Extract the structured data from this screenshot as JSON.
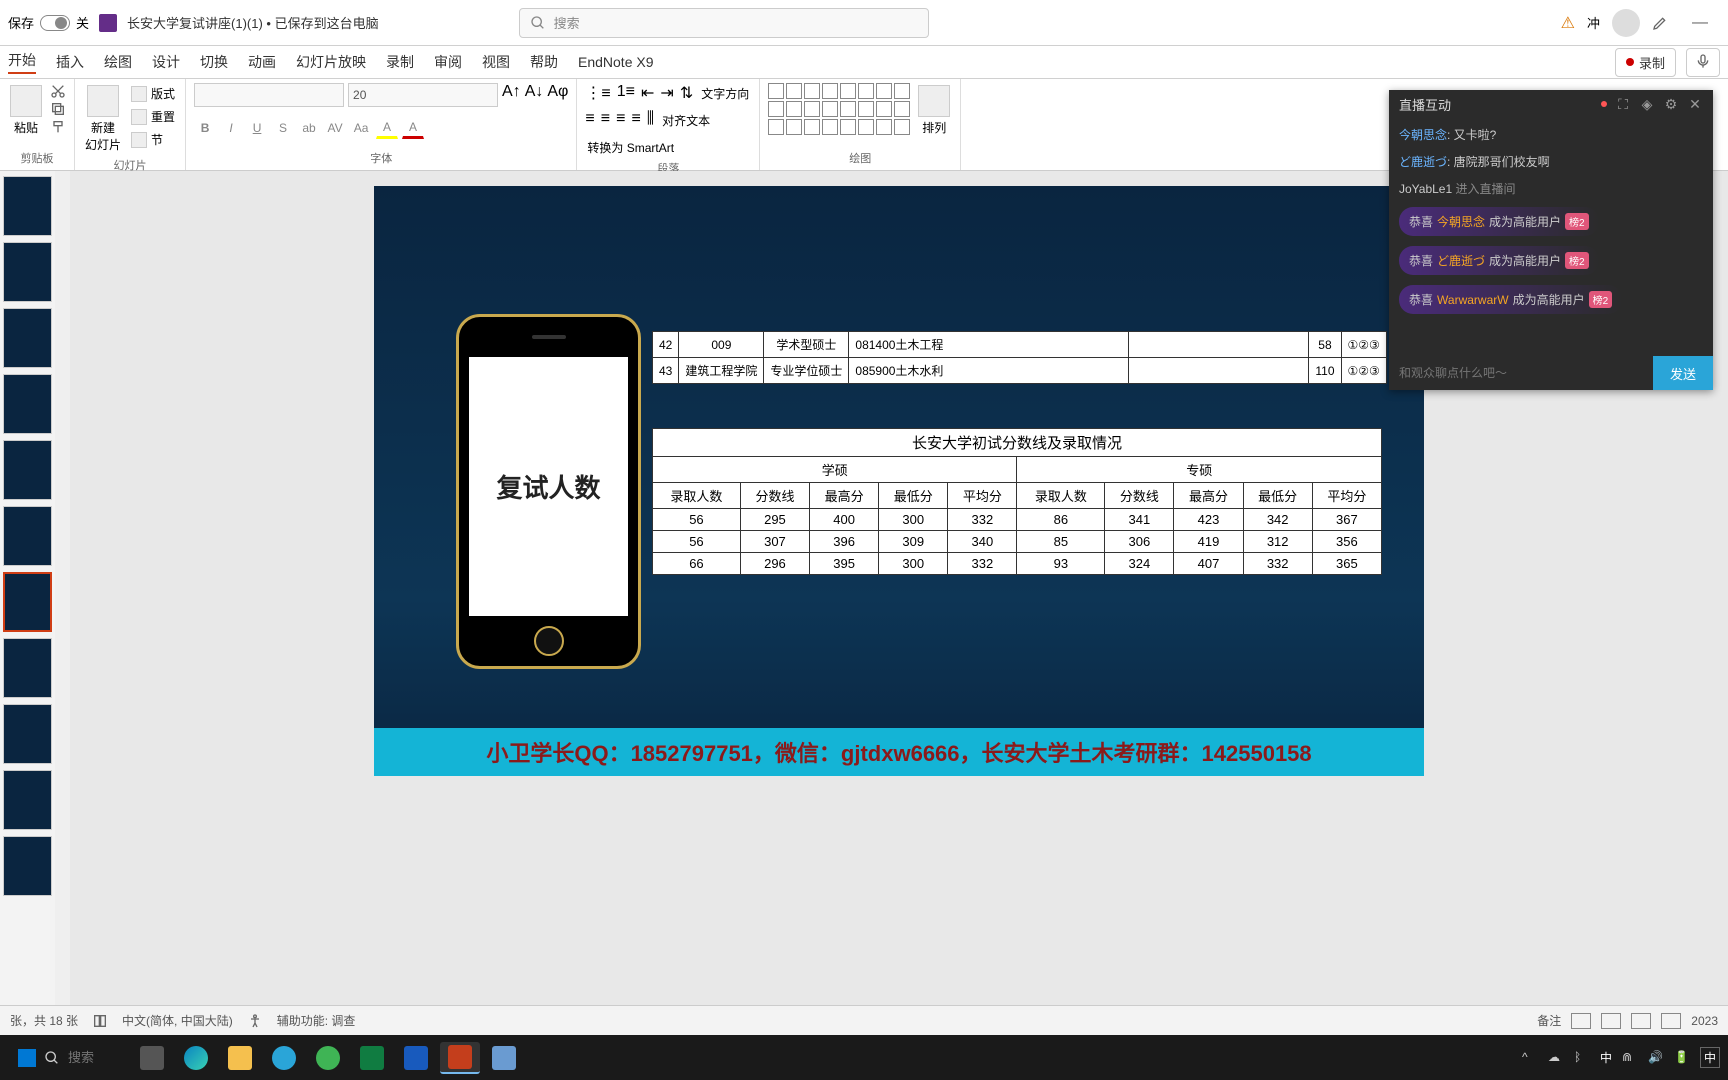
{
  "titlebar": {
    "autosave_label": "保存",
    "autosave_state": "关",
    "doc_title": "长安大学复试讲座(1)(1) • 已保存到这台电脑",
    "search_placeholder": "搜索",
    "user_name": "冲",
    "warn": "⚠"
  },
  "tabs": [
    "开始",
    "插入",
    "绘图",
    "设计",
    "切换",
    "动画",
    "幻灯片放映",
    "录制",
    "审阅",
    "视图",
    "帮助",
    "EndNote X9"
  ],
  "record_btn": "录制",
  "ribbon": {
    "groups": {
      "clipboard": {
        "label": "剪贴板",
        "paste": "粘贴"
      },
      "slides": {
        "label": "幻灯片",
        "new_slide": "新建\n幻灯片",
        "layout": "版式",
        "reset": "重置",
        "section": "节"
      },
      "font": {
        "label": "字体",
        "size": "20"
      },
      "paragraph": {
        "label": "段落",
        "text_dir": "文字方向",
        "align_text": "对齐文本",
        "convert_smartart": "转换为 SmartArt"
      },
      "drawing": {
        "label": "绘图",
        "arrange": "排列"
      }
    }
  },
  "slide": {
    "phone_text": "复试人数",
    "top_table": {
      "rows": [
        [
          "42",
          "009",
          "学术型硕士",
          "081400土木工程",
          "",
          "58",
          "①②③"
        ],
        [
          "43",
          "建筑工程学院",
          "专业学位硕士",
          "085900土木水利",
          "",
          "110",
          "①②③"
        ]
      ]
    },
    "score_table": {
      "title": "长安大学初试分数线及录取情况",
      "group_headers": [
        "学硕",
        "专硕"
      ],
      "columns": [
        "录取人数",
        "分数线",
        "最高分",
        "最低分",
        "平均分",
        "录取人数",
        "分数线",
        "最高分",
        "最低分",
        "平均分"
      ],
      "data": [
        [
          "56",
          "295",
          "400",
          "300",
          "332",
          "86",
          "341",
          "423",
          "342",
          "367"
        ],
        [
          "56",
          "307",
          "396",
          "309",
          "340",
          "85",
          "306",
          "419",
          "312",
          "356"
        ],
        [
          "66",
          "296",
          "395",
          "300",
          "332",
          "93",
          "324",
          "407",
          "332",
          "365"
        ]
      ]
    },
    "banner": "小卫学长QQ：1852797751，微信：gjtdxw6666，长安大学土木考研群：142550158"
  },
  "chat": {
    "title": "直播互动",
    "messages": [
      {
        "user": "今朝思念",
        "text": ": 又卡啦?"
      },
      {
        "user": "ど鹿逝づ",
        "text": ": 唐院那哥们校友啊"
      }
    ],
    "system": {
      "user": "JoYabLe1",
      "text": " 进入直播间"
    },
    "badges": [
      {
        "pre": "恭喜 ",
        "user": "今朝思念",
        "post": " 成为高能用户",
        "tag": "榜2"
      },
      {
        "pre": "恭喜 ",
        "user": "ど鹿逝づ",
        "post": " 成为高能用户",
        "tag": "榜2"
      },
      {
        "pre": "恭喜 ",
        "user": "WarwarwarW",
        "post": " 成为高能用户",
        "tag": "榜2"
      }
    ],
    "input_placeholder": "和观众聊点什么吧～",
    "send": "发送"
  },
  "statusbar": {
    "slide_info": "张，共 18 张",
    "lang": "中文(简体, 中国大陆)",
    "accessibility": "辅助功能: 调查",
    "notes": "备注",
    "year": "2023"
  },
  "taskbar": {
    "search_placeholder": "搜索",
    "ime": "中",
    "ime2": "中"
  },
  "colors": {
    "accent": "#d03e15",
    "slide_bg": "#0a2540",
    "banner_bg": "#14b4d6",
    "banner_text": "#8b1a1a"
  },
  "chart_data": {
    "type": "table",
    "title": "长安大学初试分数线及录取情况",
    "group_headers": [
      "学硕",
      "专硕"
    ],
    "columns": [
      "录取人数",
      "分数线",
      "最高分",
      "最低分",
      "平均分",
      "录取人数",
      "分数线",
      "最高分",
      "最低分",
      "平均分"
    ],
    "rows": [
      [
        56,
        295,
        400,
        300,
        332,
        86,
        341,
        423,
        342,
        367
      ],
      [
        56,
        307,
        396,
        309,
        340,
        85,
        306,
        419,
        312,
        356
      ],
      [
        66,
        296,
        395,
        300,
        332,
        93,
        324,
        407,
        332,
        365
      ]
    ]
  }
}
